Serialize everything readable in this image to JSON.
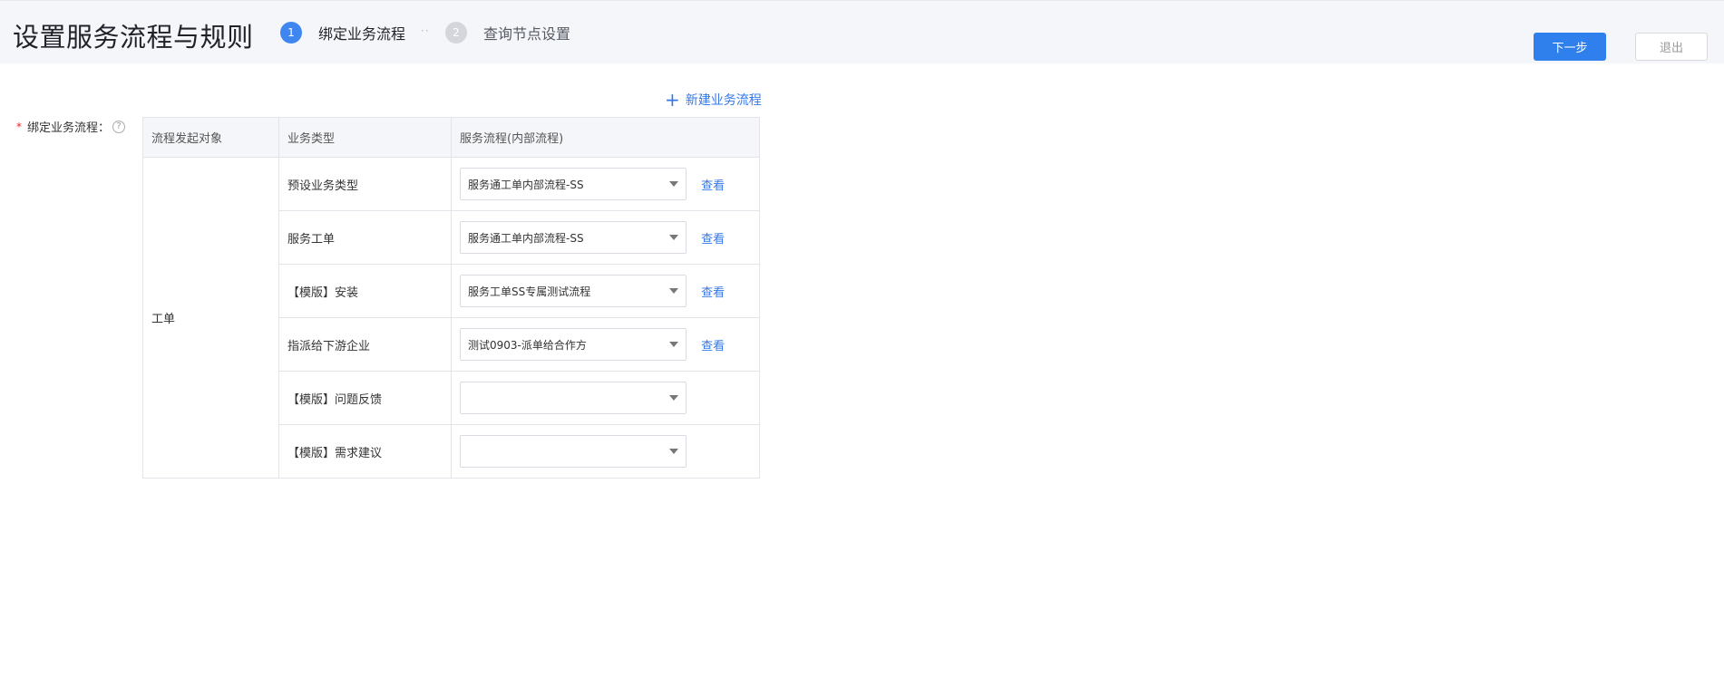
{
  "header": {
    "title": "设置服务流程与规则",
    "steps": [
      {
        "num": "1",
        "label": "绑定业务流程"
      },
      {
        "num": "2",
        "label": "查询节点设置"
      }
    ],
    "step_separator": "··",
    "next_label": "下一步",
    "exit_label": "退出"
  },
  "form": {
    "required_mark": "*",
    "label": "绑定业务流程：",
    "help_icon": "?",
    "new_flow_icon": "+",
    "new_flow_label": "新建业务流程",
    "columns": [
      "流程发起对象",
      "业务类型",
      "服务流程(内部流程)"
    ],
    "initiator": "工单",
    "view_label": "查看",
    "rows": [
      {
        "type": "预设业务类型",
        "flow": "服务通工单内部流程-SS"
      },
      {
        "type": "服务工单",
        "flow": "服务通工单内部流程-SS"
      },
      {
        "type": "【模版】安装",
        "flow": "服务工单SS专属测试流程"
      },
      {
        "type": "指派给下游企业",
        "flow": "测试0903-派单给合作方"
      },
      {
        "type": "【模版】问题反馈",
        "flow": ""
      },
      {
        "type": "【模版】需求建议",
        "flow": ""
      }
    ]
  }
}
